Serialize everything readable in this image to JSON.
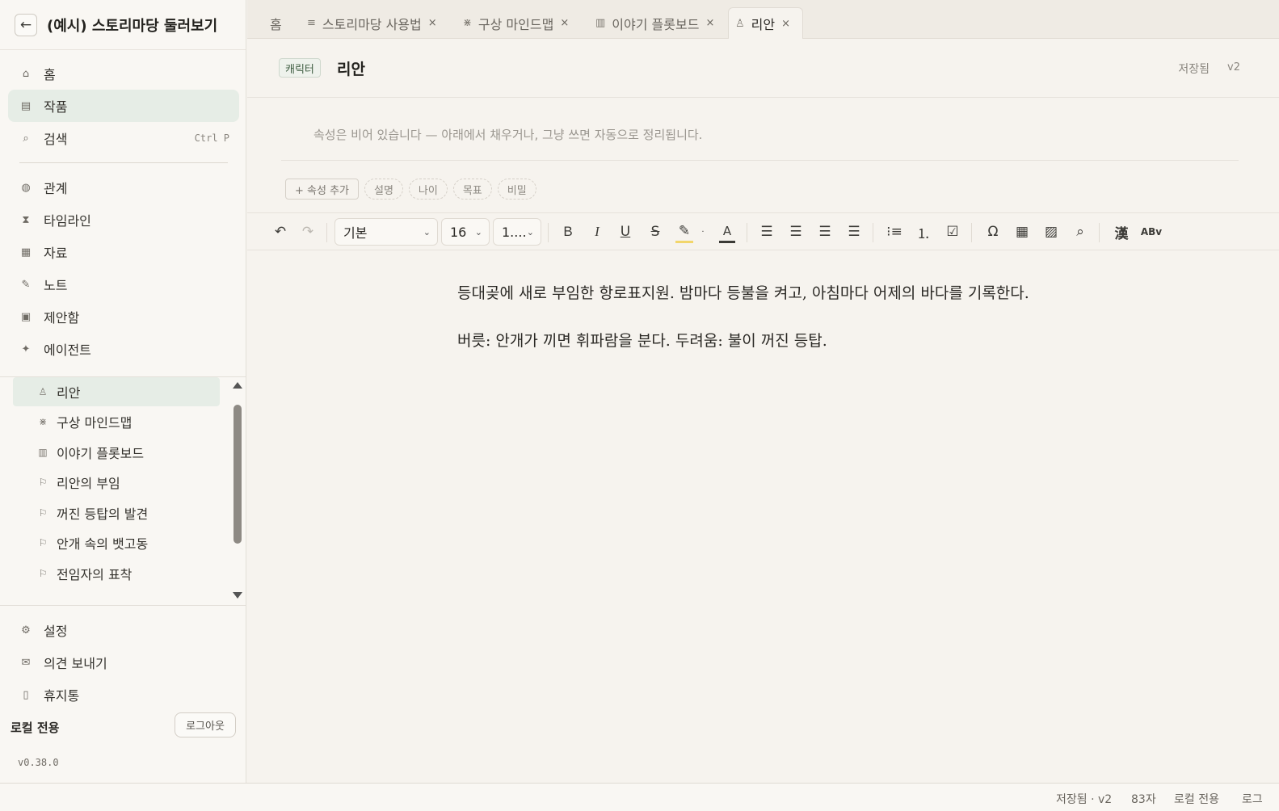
{
  "project": {
    "back_label": "←",
    "title": "(예시) 스토리마당 둘러보기"
  },
  "nav": {
    "home": "홈",
    "works": "작품",
    "search": "검색",
    "search_shortcut": "Ctrl P",
    "relations": "관계",
    "timeline": "타임라인",
    "materials": "자료",
    "notes": "노트",
    "inbox": "제안함",
    "agent": "에이전트"
  },
  "tree": [
    {
      "label": "리안",
      "icon": "person-icon",
      "active": true
    },
    {
      "label": "구상 마인드맵",
      "icon": "mindmap-icon"
    },
    {
      "label": "이야기 플롯보드",
      "icon": "plotboard-icon"
    },
    {
      "label": "리안의 부임",
      "icon": "flag-icon"
    },
    {
      "label": "꺼진 등탑의 발견",
      "icon": "flag-icon"
    },
    {
      "label": "안개 속의 뱃고동",
      "icon": "flag-icon"
    },
    {
      "label": "전임자의 표착",
      "icon": "flag-icon"
    }
  ],
  "bottom_nav": {
    "settings": "설정",
    "feedback": "의견 보내기",
    "trash": "휴지통"
  },
  "account": {
    "local_label": "로컬 전용",
    "logout": "로그아웃",
    "version": "v0.38.0"
  },
  "tabs": [
    {
      "label": "홈"
    },
    {
      "label": "스토리마당 사용법",
      "close": "×"
    },
    {
      "label": "구상 마인드맵",
      "close": "×"
    },
    {
      "label": "이야기 플롯보드",
      "close": "×"
    },
    {
      "label": "리안",
      "close": "×"
    }
  ],
  "doc": {
    "kind": "캐릭터",
    "title": "리안",
    "saved": "저장됨",
    "version": "v2",
    "props_empty": "속성은 비어 있습니다 — 아래에서 채우거나, 그냥 쓰면 자동으로 정리됩니다.",
    "chips": [
      "+ 속성 추가",
      "설명",
      "나이",
      "목표",
      "비밀"
    ]
  },
  "toolbar": {
    "style_select": "기본",
    "size_select": "16",
    "line_select": "1...."
  },
  "editor": {
    "paragraphs": [
      "등대곶에 새로 부임한 항로표지원. 밤마다 등불을 켜고, 아침마다 어제의 바다를 기록한다.",
      "버릇: 안개가 끼면 휘파람을 분다. 두려움: 불이 꺼진 등탑."
    ]
  },
  "status": {
    "saved": "저장됨 · v2",
    "chars": "83자",
    "mode": "로컬 전용",
    "log": "로그"
  },
  "colors": {
    "accent_bg": "#e6ede6",
    "badge_text": "#3d5c40",
    "highlight": "#f2d66b"
  }
}
